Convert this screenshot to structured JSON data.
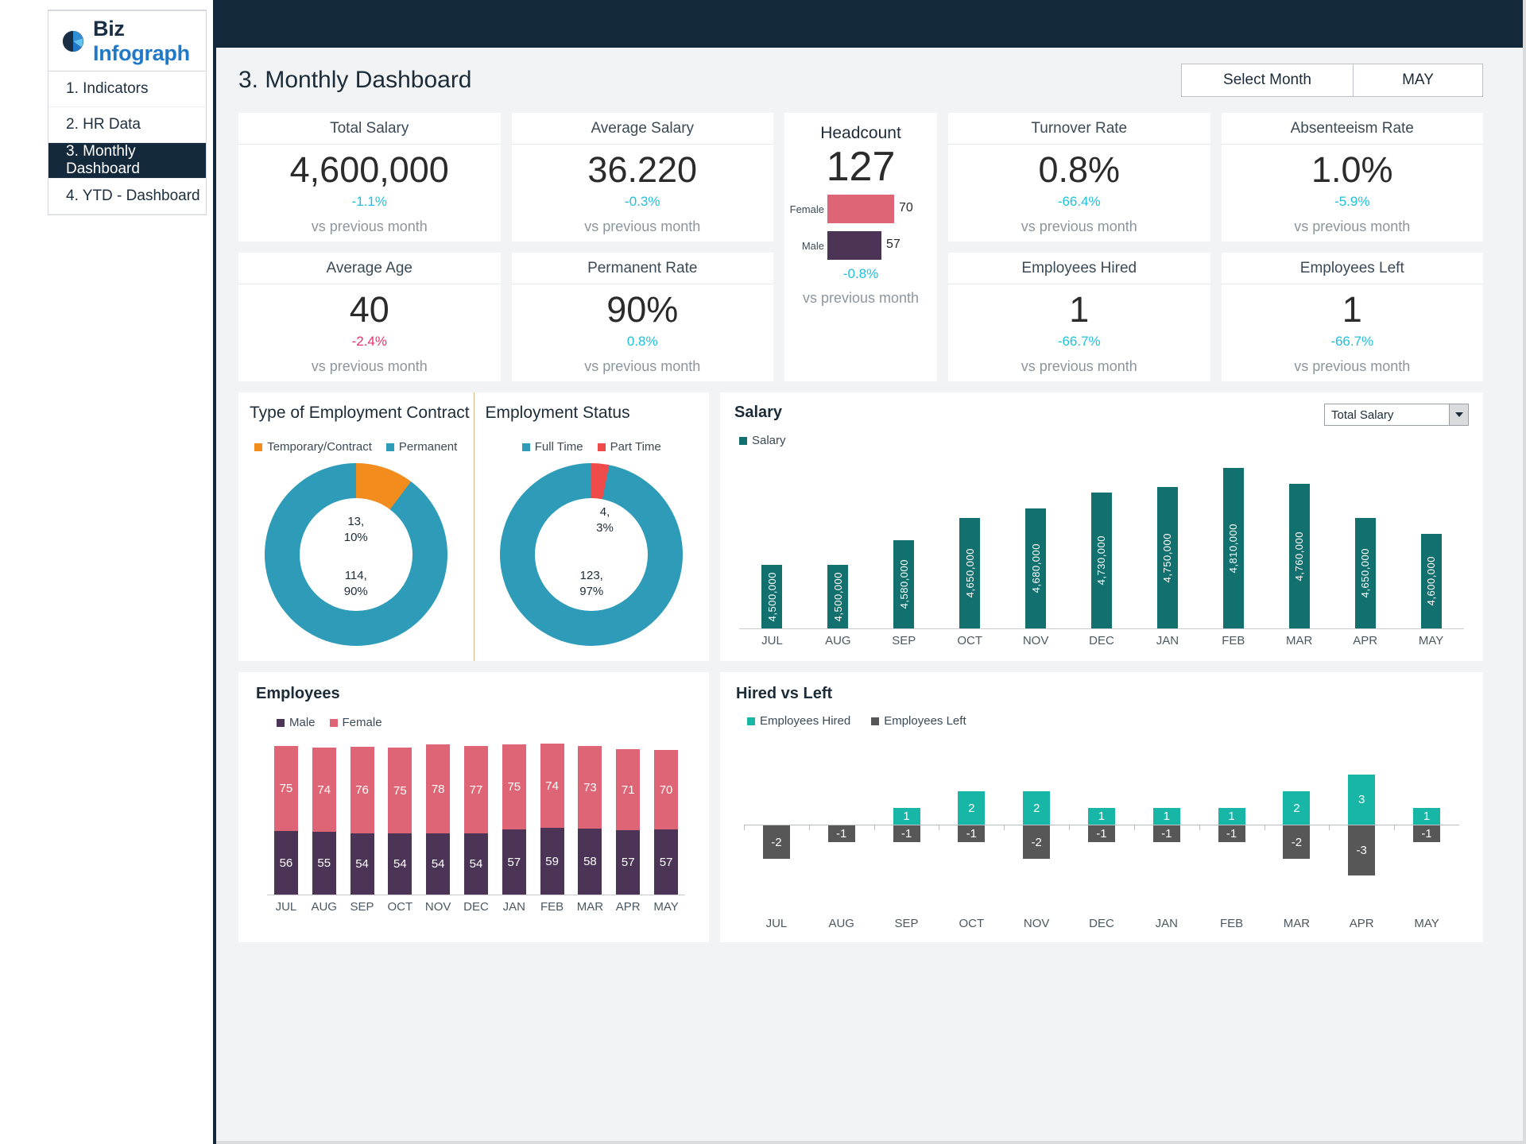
{
  "brand": {
    "name_first": "Biz",
    "name_second": "Infograph",
    "logo_icon": "pie-chart-icon"
  },
  "sidebar": {
    "items": [
      {
        "label": "1. Indicators",
        "active": false
      },
      {
        "label": "2. HR Data",
        "active": false
      },
      {
        "label": "3. Monthly Dashboard",
        "active": true
      },
      {
        "label": "4. YTD - Dashboard",
        "active": false
      }
    ]
  },
  "header": {
    "title": "3. Monthly Dashboard",
    "month_picker_label": "Select Month",
    "month_picker_value": "MAY"
  },
  "colors": {
    "navy": "#15293c",
    "teal": "#12706e",
    "cyan_delta": "#1fc0dd",
    "pink_delta": "#e8326e",
    "donut_blue": "#2e9cb8",
    "donut_orange": "#f28c1c",
    "donut_red": "#ef4b4b",
    "female_pink": "#de6575",
    "male_purple": "#4b3456",
    "hired_green": "#17b6a6",
    "left_gray": "#575757"
  },
  "kpis": [
    {
      "title": "Total Salary",
      "value": "4,600,000",
      "delta": "-1.1%",
      "delta_color": "cyan",
      "sub": "vs previous month"
    },
    {
      "title": "Average Salary",
      "value": "36.220",
      "delta": "-0.3%",
      "delta_color": "cyan",
      "sub": "vs previous month"
    },
    {
      "title": "Turnover Rate",
      "value": "0.8%",
      "delta": "-66.4%",
      "delta_color": "cyan",
      "sub": "vs previous month"
    },
    {
      "title": "Absenteeism Rate",
      "value": "1.0%",
      "delta": "-5.9%",
      "delta_color": "cyan",
      "sub": "vs previous month"
    },
    {
      "title": "Average Age",
      "value": "40",
      "delta": "-2.4%",
      "delta_color": "pink",
      "sub": "vs previous month"
    },
    {
      "title": "Permanent Rate",
      "value": "90%",
      "delta": "0.8%",
      "delta_color": "cyan",
      "sub": "vs previous month"
    },
    {
      "title": "Employees Hired",
      "value": "1",
      "delta": "-66.7%",
      "delta_color": "cyan",
      "sub": "vs previous month"
    },
    {
      "title": "Employees Left",
      "value": "1",
      "delta": "-66.7%",
      "delta_color": "cyan",
      "sub": "vs previous month"
    }
  ],
  "headcount": {
    "title": "Headcount",
    "total": "127",
    "delta": "-0.8%",
    "sub": "vs previous month",
    "bars": [
      {
        "label": "Female",
        "value": "70",
        "pct": 100
      },
      {
        "label": "Male",
        "value": "57",
        "pct": 81
      }
    ]
  },
  "chart_data": [
    {
      "type": "pie",
      "title": "Type of Employment Contract",
      "legend": [
        "Temporary/Contract",
        "Permanent"
      ],
      "legend_position": "top",
      "labels": [
        "Temporary/Contract",
        "Permanent"
      ],
      "values": [
        13,
        114
      ],
      "percents": [
        "10%",
        "90%"
      ],
      "slice_labels": [
        "13,\n10%",
        "114,\n90%"
      ],
      "colors": [
        "#f28c1c",
        "#2e9cb8"
      ]
    },
    {
      "type": "pie",
      "title": "Employment Status",
      "legend": [
        "Full Time",
        "Part Time"
      ],
      "legend_position": "top",
      "labels": [
        "Full Time",
        "Part Time"
      ],
      "values": [
        123,
        4
      ],
      "percents": [
        "97%",
        "3%"
      ],
      "slice_labels": [
        "123,\n97%",
        "4,\n3%"
      ],
      "colors": [
        "#2e9cb8",
        "#ef4b4b"
      ]
    },
    {
      "type": "bar",
      "title": "Salary",
      "legend": [
        "Salary"
      ],
      "dropdown_value": "Total Salary",
      "categories": [
        "JUL",
        "AUG",
        "SEP",
        "OCT",
        "NOV",
        "DEC",
        "JAN",
        "FEB",
        "MAR",
        "APR",
        "MAY"
      ],
      "values": [
        4500000,
        4500000,
        4580000,
        4650000,
        4680000,
        4730000,
        4750000,
        4810000,
        4760000,
        4650000,
        4600000
      ],
      "value_labels": [
        "4,500,000",
        "4,500,000",
        "4,580,000",
        "4,650,000",
        "4,680,000",
        "4,730,000",
        "4,750,000",
        "4,810,000",
        "4,760,000",
        "4,650,000",
        "4,600,000"
      ],
      "xlabel": "",
      "ylabel": "",
      "ylim": [
        0,
        4810000
      ],
      "grid": false,
      "color": "#12706e"
    },
    {
      "type": "bar",
      "subtype": "stacked",
      "title": "Employees",
      "legend": [
        "Male",
        "Female"
      ],
      "legend_position": "top",
      "categories": [
        "JUL",
        "AUG",
        "SEP",
        "OCT",
        "NOV",
        "DEC",
        "JAN",
        "FEB",
        "MAR",
        "APR",
        "MAY"
      ],
      "series": [
        {
          "name": "Male",
          "values": [
            56,
            55,
            54,
            54,
            54,
            54,
            57,
            59,
            58,
            57,
            57
          ],
          "color": "#4b3456"
        },
        {
          "name": "Female",
          "values": [
            75,
            74,
            76,
            75,
            78,
            77,
            75,
            74,
            73,
            71,
            70
          ],
          "color": "#de6575"
        }
      ],
      "xlabel": "",
      "ylabel": "",
      "grid": false
    },
    {
      "type": "bar",
      "subtype": "diverging",
      "title": "Hired vs Left",
      "legend": [
        "Employees Hired",
        "Employees Left"
      ],
      "legend_position": "top",
      "categories": [
        "JUL",
        "AUG",
        "SEP",
        "OCT",
        "NOV",
        "DEC",
        "JAN",
        "FEB",
        "MAR",
        "APR",
        "MAY"
      ],
      "series": [
        {
          "name": "Employees Hired",
          "values": [
            0,
            0,
            1,
            2,
            2,
            1,
            1,
            1,
            2,
            3,
            1
          ],
          "color": "#17b6a6"
        },
        {
          "name": "Employees Left",
          "values": [
            -2,
            -1,
            -1,
            -1,
            -2,
            -1,
            -1,
            -1,
            -2,
            -3,
            -1
          ],
          "color": "#575757"
        }
      ],
      "xlabel": "",
      "ylabel": "",
      "grid": false
    }
  ]
}
